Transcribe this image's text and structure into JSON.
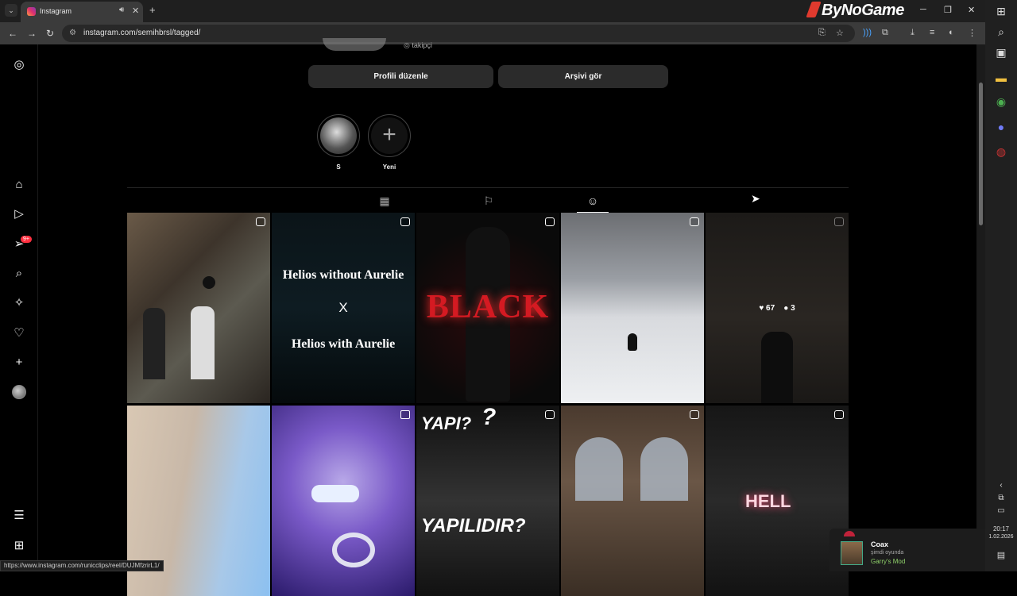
{
  "browser": {
    "tab_title": "Instagram",
    "url": "instagram.com/semihbrsl/tagged/",
    "brand": "ByNoGame",
    "status_url": "https://www.instagram.com/runicclips/reel/DUJMfzrirL1/"
  },
  "profile": {
    "followers_text": "takipçi",
    "edit_profile": "Profili düzenle",
    "view_archive": "Arşivi gör",
    "highlights": [
      {
        "label": "S"
      },
      {
        "label": "Yeni"
      }
    ]
  },
  "notifications_badge": "9+",
  "tiles": {
    "t2_top": "Helios without Aurelie",
    "t2_mid": "X",
    "t2_bottom": "Helios with Aurelie",
    "t3_word": "BLACK",
    "t5_likes": "67",
    "t5_comments": "3",
    "t8_q": "?",
    "t8_yapi": "YAPI?",
    "t8_yapilir": "YAPILIDIR?",
    "t10_word": "HELL"
  },
  "toast": {
    "name": "Coax",
    "status": "şimdi oyunda",
    "game": "Garry's Mod"
  },
  "clock": {
    "time": "20:17",
    "date": "1.02.2026"
  }
}
